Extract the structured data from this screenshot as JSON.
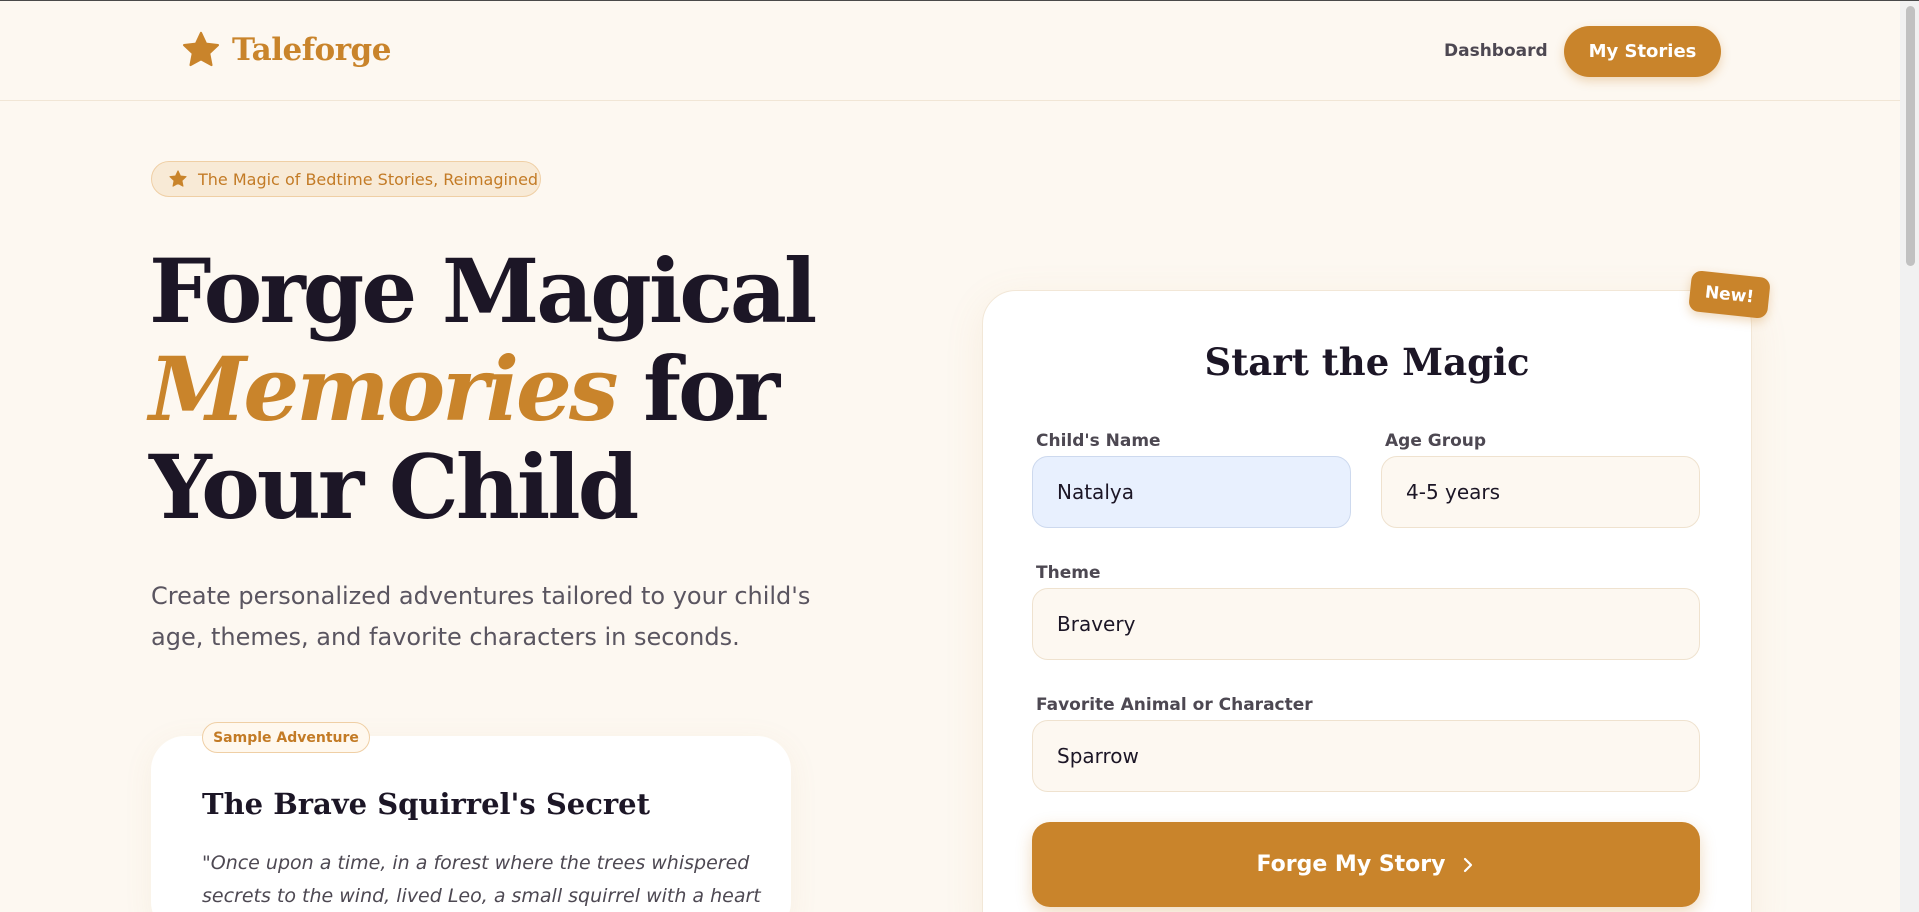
{
  "header": {
    "brand": "Taleforge",
    "brand_icon": "star-icon",
    "nav_link": "Dashboard",
    "nav_button": "My Stories"
  },
  "hero": {
    "badge_icon": "star-icon",
    "badge": "The Magic of Bedtime Stories, Reimagined",
    "title_line1": "Forge Magical",
    "title_accent": "Memories",
    "title_line2_rest": " for",
    "title_line3": "Your Child",
    "subtitle": "Create personalized adventures tailored to your child's age, themes, and favorite characters in seconds."
  },
  "sample": {
    "tag": "Sample Adventure",
    "title": "The Brave Squirrel's Secret",
    "quote": "\"Once upon a time, in a forest where the trees whispered secrets to the wind, lived Leo, a small squirrel with a heart"
  },
  "form": {
    "badge": "New!",
    "title": "Start the Magic",
    "child_name_label": "Child's Name",
    "child_name_value": "Natalya",
    "age_group_label": "Age Group",
    "age_group_value": "4-5 years",
    "theme_label": "Theme",
    "theme_value": "Bravery",
    "favorite_label": "Favorite Animal or Character",
    "favorite_value": "Sparrow",
    "submit": "Forge My Story",
    "submit_icon": "chevron-right-icon"
  },
  "colors": {
    "accent": "#c9842b",
    "background": "#fdf8f1",
    "text": "#1c1626"
  }
}
